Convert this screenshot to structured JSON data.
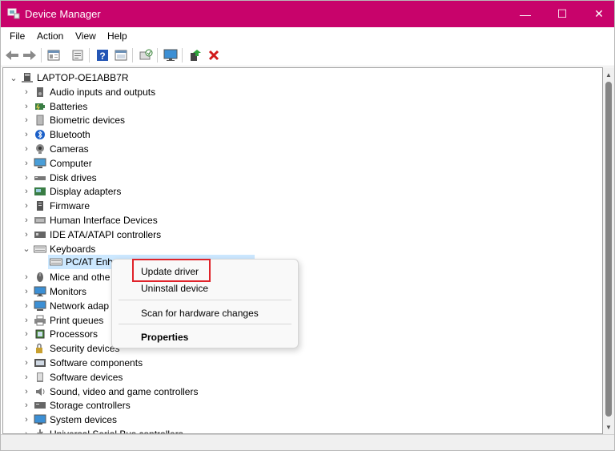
{
  "window": {
    "title": "Device Manager",
    "titlebar_color": "#c8036b",
    "controls": {
      "minimize": "—",
      "maximize": "☐",
      "close": "✕"
    }
  },
  "menu": {
    "file": "File",
    "action": "Action",
    "view": "View",
    "help": "Help"
  },
  "toolbar": {
    "icons": [
      "back-icon",
      "forward-icon",
      "properties-icon",
      "print-icon",
      "help-icon",
      "action-icon",
      "scan-icon",
      "monitor-icon",
      "update-driver-icon",
      "uninstall-icon"
    ]
  },
  "tree": {
    "root": "LAPTOP-OE1ABB7R",
    "items": [
      {
        "label": "Audio inputs and outputs",
        "icon": "speaker-icon"
      },
      {
        "label": "Batteries",
        "icon": "battery-icon"
      },
      {
        "label": "Biometric devices",
        "icon": "biometric-icon"
      },
      {
        "label": "Bluetooth",
        "icon": "bluetooth-icon"
      },
      {
        "label": "Cameras",
        "icon": "camera-icon"
      },
      {
        "label": "Computer",
        "icon": "computer-icon"
      },
      {
        "label": "Disk drives",
        "icon": "disk-icon"
      },
      {
        "label": "Display adapters",
        "icon": "display-adapter-icon"
      },
      {
        "label": "Firmware",
        "icon": "firmware-icon"
      },
      {
        "label": "Human Interface Devices",
        "icon": "hid-icon"
      },
      {
        "label": "IDE ATA/ATAPI controllers",
        "icon": "ide-icon"
      },
      {
        "label": "Keyboards",
        "icon": "keyboard-icon",
        "expanded": true
      },
      {
        "label": "Mice and othe",
        "icon": "mouse-icon"
      },
      {
        "label": "Monitors",
        "icon": "monitor-icon"
      },
      {
        "label": "Network adap",
        "icon": "network-icon"
      },
      {
        "label": "Print queues",
        "icon": "printer-icon"
      },
      {
        "label": "Processors",
        "icon": "processor-icon"
      },
      {
        "label": "Security devices",
        "icon": "security-icon"
      },
      {
        "label": "Software components",
        "icon": "software-component-icon"
      },
      {
        "label": "Software devices",
        "icon": "software-device-icon"
      },
      {
        "label": "Sound, video and game controllers",
        "icon": "sound-icon"
      },
      {
        "label": "Storage controllers",
        "icon": "storage-icon"
      },
      {
        "label": "System devices",
        "icon": "system-icon"
      },
      {
        "label": "Universal Serial Bus controllers",
        "icon": "usb-icon"
      }
    ],
    "keyboard_child": "PC/AT Enha"
  },
  "context_menu": {
    "update_driver": "Update driver",
    "uninstall_device": "Uninstall device",
    "scan_hardware": "Scan for hardware changes",
    "properties": "Properties"
  }
}
